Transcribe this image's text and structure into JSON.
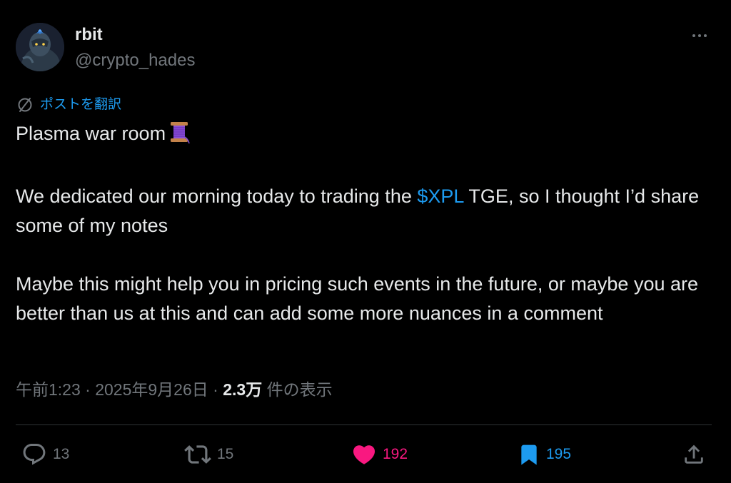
{
  "author": {
    "name": "rbit",
    "handle": "@crypto_hades"
  },
  "translate": {
    "label": "ポストを翻訳"
  },
  "post": {
    "line1": "Plasma war room",
    "para2_before": "We dedicated our morning today to trading the ",
    "cashtag": "$XPL",
    "para2_after": " TGE, so I thought I’d share some of my notes",
    "para3": "Maybe this might help you in pricing such events in the future, or maybe you are better than us at this and can add some more nuances in a comment"
  },
  "meta": {
    "time": "午前1:23",
    "separator": " · ",
    "date": "2025年9月26日",
    "views": "2.3万",
    "views_label": " 件の表示"
  },
  "actions": {
    "replies": "13",
    "reposts": "15",
    "likes": "192",
    "bookmarks": "195"
  },
  "colors": {
    "background": "#000000",
    "text": "#e7e9ea",
    "muted": "#71767b",
    "link": "#1d9bf0",
    "like": "#f91880",
    "divider": "#2f3336"
  },
  "icons": {
    "more": "more-icon",
    "translate": "translate-icon",
    "spool": "thread-spool-emoji",
    "reply": "reply-icon",
    "repost": "repost-icon",
    "like": "heart-icon",
    "bookmark": "bookmark-icon",
    "share": "share-icon"
  }
}
